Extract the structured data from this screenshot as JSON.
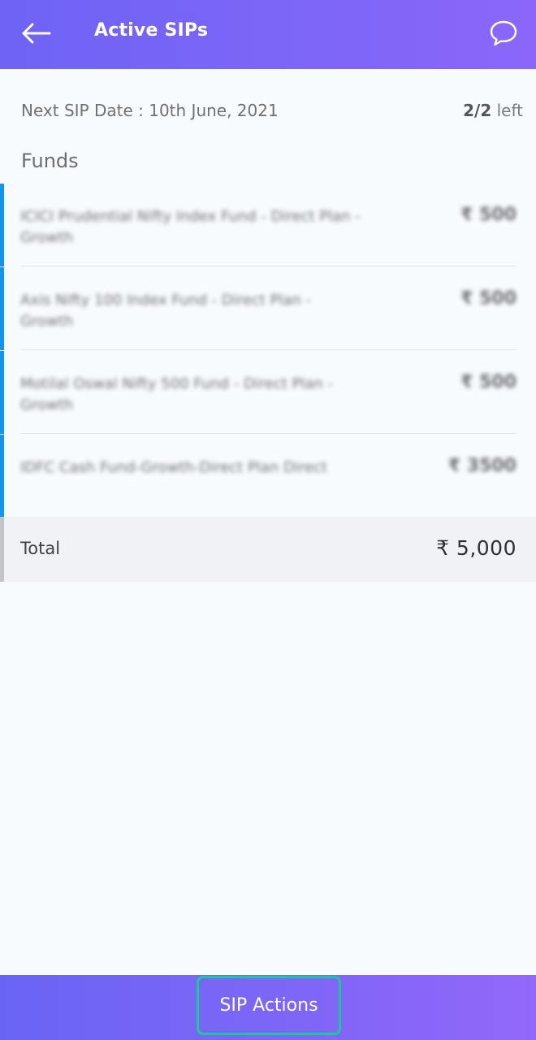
{
  "header": {
    "title": "Active SIPs",
    "back_icon": "arrow-left-icon",
    "chat_icon": "chat-bubble-icon"
  },
  "info": {
    "next_sip": "Next SIP Date : 10th June, 2021",
    "left_count": "2/2",
    "left_suffix": " left"
  },
  "funds": {
    "heading": "Funds",
    "items": [
      {
        "name": "ICICI Prudential Nifty Index Fund - Direct Plan - Growth",
        "amount": "₹ 500"
      },
      {
        "name": "Axis Nifty 100 Index Fund - Direct Plan - Growth",
        "amount": "₹ 500"
      },
      {
        "name": "Motilal Oswal Nifty 500 Fund - Direct Plan - Growth",
        "amount": "₹ 500"
      },
      {
        "name": "IDFC Cash Fund-Growth-Direct Plan Direct",
        "amount": "₹ 3500"
      }
    ]
  },
  "total": {
    "label": "Total",
    "value": "₹ 5,000"
  },
  "footer": {
    "sip_actions_label": "SIP Actions"
  },
  "colors": {
    "header_gradient_start": "#6e63f5",
    "header_gradient_end": "#8a67f9",
    "fund_accent": "#1196f0",
    "button_outline": "#1cc89b"
  }
}
